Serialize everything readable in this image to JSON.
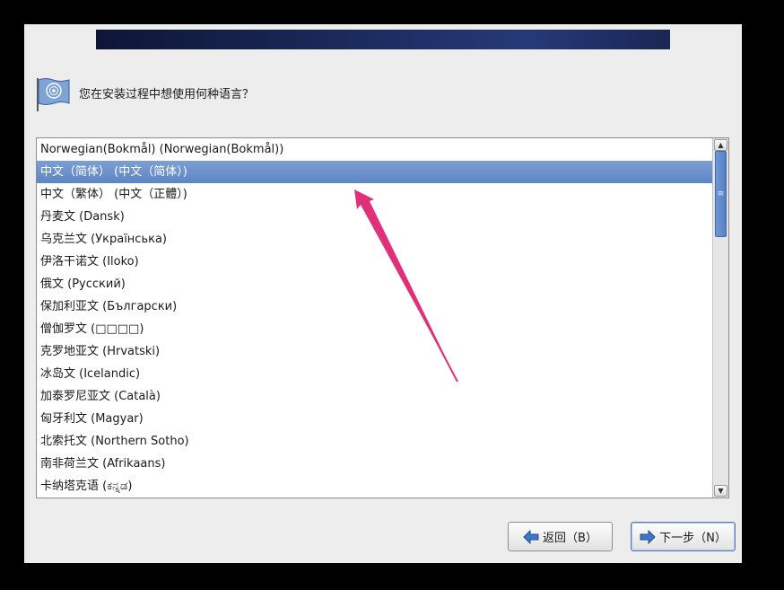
{
  "header": {
    "question": "您在安装过程中想使用何种语言？"
  },
  "language_list": {
    "items": [
      {
        "label": "Norwegian(Bokmål) (Norwegian(Bokmål))",
        "selected": false
      },
      {
        "label": "中文（简体） (中文（简体）)",
        "selected": true
      },
      {
        "label": "中文（繁体） (中文（正體）)",
        "selected": false
      },
      {
        "label": "丹麦文 (Dansk)",
        "selected": false
      },
      {
        "label": "乌克兰文 (Українська)",
        "selected": false
      },
      {
        "label": "伊洛干诺文 (Iloko)",
        "selected": false
      },
      {
        "label": "俄文 (Русский)",
        "selected": false
      },
      {
        "label": "保加利亚文 (Български)",
        "selected": false
      },
      {
        "label": "僧伽罗文 (□□□□)",
        "selected": false
      },
      {
        "label": "克罗地亚文 (Hrvatski)",
        "selected": false
      },
      {
        "label": "冰岛文 (Icelandic)",
        "selected": false
      },
      {
        "label": "加泰罗尼亚文 (Català)",
        "selected": false
      },
      {
        "label": "匈牙利文 (Magyar)",
        "selected": false
      },
      {
        "label": "北索托文 (Northern Sotho)",
        "selected": false
      },
      {
        "label": "南非荷兰文 (Afrikaans)",
        "selected": false
      },
      {
        "label": "卡纳塔克语 (ಕನ್ನಡ)",
        "selected": false
      }
    ],
    "scroll_position": 0.08
  },
  "buttons": {
    "back_label": "返回（B）",
    "next_label": "下一步（N）"
  },
  "icons": {
    "flag": "flag-icon",
    "back": "arrow-left-icon",
    "next": "arrow-right-icon",
    "annotation": "annotation-arrow"
  },
  "colors": {
    "selection": "#6b8fcb",
    "annotation_arrow": "#e0307a",
    "banner": "#1c2a5c"
  }
}
